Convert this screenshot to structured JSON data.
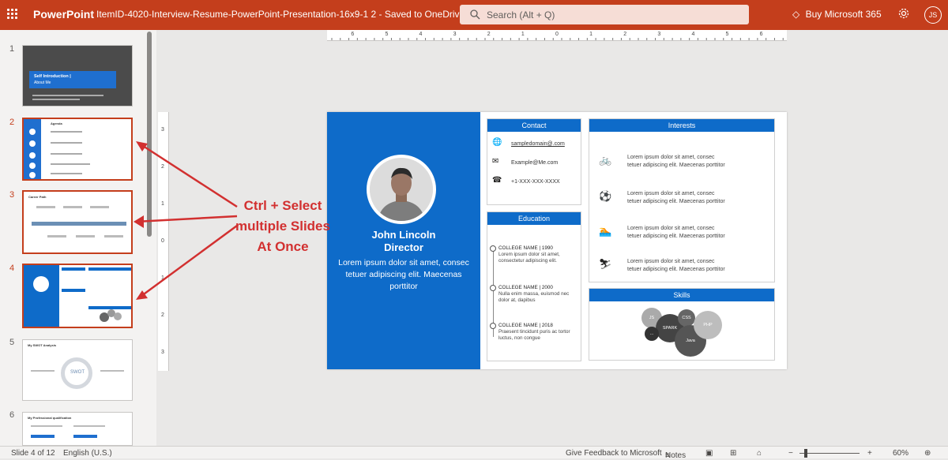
{
  "app": {
    "name": "PowerPoint",
    "doc_title": "ItemID-4020-Interview-Resume-PowerPoint-Presentation-16x9-1 2  -  Saved to OneDrive",
    "save_chevron": "⌄"
  },
  "search": {
    "placeholder": "Search (Alt + Q)"
  },
  "header": {
    "buy_label": "Buy Microsoft 365",
    "avatar_initials": "JS"
  },
  "thumbnails": [
    {
      "num": "1",
      "title": "Self Introduction |",
      "subtitle": "About Me"
    },
    {
      "num": "2",
      "title": "Agenda"
    },
    {
      "num": "3",
      "title": "Career Path"
    },
    {
      "num": "4"
    },
    {
      "num": "5",
      "title": "My SWOT Analysis",
      "center": "SWOT"
    },
    {
      "num": "6",
      "title": "My Professional qualification"
    }
  ],
  "annotation": {
    "line1": "Ctrl + Select",
    "line2": "multiple Slides",
    "line3": "At Once"
  },
  "ruler": {
    "h": [
      "6",
      "5",
      "4",
      "3",
      "2",
      "1",
      "0",
      "1",
      "2",
      "3",
      "4",
      "5",
      "6"
    ],
    "v": [
      "3",
      "2",
      "1",
      "0",
      "1",
      "2",
      "3"
    ]
  },
  "slide": {
    "name": "John Lincoln",
    "role": "Director",
    "lorem": "Lorem ipsum dolor sit amet, consec tetuer adipiscing elit. Maecenas porttitor",
    "contact": {
      "title": "Contact",
      "items": [
        {
          "icon": "🌐",
          "text": "sampledomain@.com"
        },
        {
          "icon": "✉",
          "text": "Example@Me.com"
        },
        {
          "icon": "☎",
          "text": "+1-XXX-XXX-XXXX"
        }
      ]
    },
    "education": {
      "title": "Education",
      "items": [
        {
          "head": "COLLEGE NAME | 1990",
          "l1": "Lorem ipsum dolor sit amet,",
          "l2": "consectetur adipiscing elit."
        },
        {
          "head": "COLLEGE NAME | 2000",
          "l1": "Nulla enim massa, euismod nec",
          "l2": "dolor at, dapibus"
        },
        {
          "head": "COLLEGE NAME | 2018",
          "l1": "Praesent tincidunt puris ac tortor",
          "l2": "luctus, non congue"
        }
      ]
    },
    "interests": {
      "title": "Interests",
      "items": [
        {
          "icon": "🚲",
          "l1": "Lorem ipsum dolor sit amet, consec",
          "l2": "tetuer adipiscing elit. Maecenas porttitor"
        },
        {
          "icon": "⚽",
          "l1": "Lorem ipsum dolor sit amet, consec",
          "l2": "tetuer adipiscing elit. Maecenas porttitor"
        },
        {
          "icon": "🏊",
          "l1": "Lorem ipsum dolor sit amet, consec",
          "l2": "tetuer adipiscing elit. Maecenas porttitor"
        },
        {
          "icon": "⛷",
          "l1": "Lorem ipsum dolor sit amet, consec",
          "l2": "tetuer adipiscing elit. Maecenas porttitor"
        }
      ]
    },
    "skills": {
      "title": "Skills",
      "bubbles": [
        {
          "label": "JS"
        },
        {
          "label": "SPARK"
        },
        {
          "label": "CSS"
        },
        {
          "label": "Java"
        },
        {
          "label": "..."
        },
        {
          "label": "PHP"
        }
      ]
    }
  },
  "status": {
    "slide_of": "Slide 4 of 12",
    "language": "English (U.S.)",
    "feedback": "Give Feedback to Microsoft",
    "notes": "Notes",
    "zoom": "60%"
  }
}
